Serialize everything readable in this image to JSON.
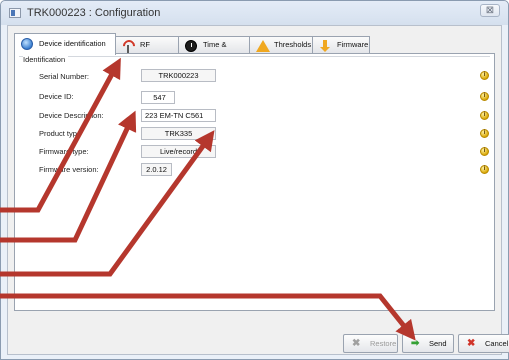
{
  "window": {
    "title": "TRK000223 : Configuration",
    "close_glyph": "⊠"
  },
  "tabs": [
    {
      "label": "Device identification",
      "icon": "globe-icon",
      "active": true
    },
    {
      "label": "RF Settings",
      "icon": "antenna-icon",
      "active": false
    },
    {
      "label": "Time & Period",
      "icon": "clock-icon",
      "active": false
    },
    {
      "label": "Thresholds",
      "icon": "warning-icon",
      "active": false
    },
    {
      "label": "Firmware",
      "icon": "download-arrow-icon",
      "active": false
    }
  ],
  "identification": {
    "legend": "Identification",
    "rows": [
      {
        "label": "Serial Number:",
        "value": "TRK000223",
        "editable": false
      },
      {
        "label": "Device ID:",
        "value": "547",
        "editable": true
      },
      {
        "label": "Device Description:",
        "value": "223 EM-TN C561",
        "editable": true
      },
      {
        "label": "Product typ",
        "value": "TRK335",
        "editable": false
      },
      {
        "label": "Firmware type:",
        "value": "Live/record",
        "editable": false
      },
      {
        "label": "Firmware version:",
        "value": "2.0.12",
        "editable": false
      }
    ],
    "info_glyph": "i"
  },
  "buttons": {
    "restore": "Restore",
    "send": "Send",
    "cancel": "Cancel"
  },
  "icons": {
    "restore": "✖",
    "send": "➡",
    "cancel": "✖"
  },
  "colors": {
    "annotation_arrow": "#b5372d"
  }
}
